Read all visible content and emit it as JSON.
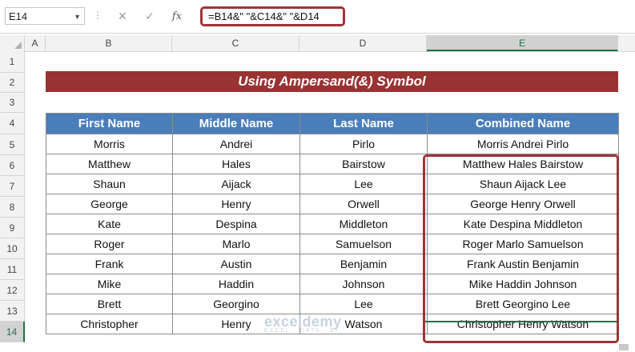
{
  "formula_bar": {
    "name_box": "E14",
    "cancel_icon": "✕",
    "enter_icon": "✓",
    "fx_label": "fx",
    "formula": "=B14&\" \"&C14&\" \"&D14"
  },
  "columns": [
    "A",
    "B",
    "C",
    "D",
    "E"
  ],
  "rows": [
    "1",
    "2",
    "3",
    "4",
    "5",
    "6",
    "7",
    "8",
    "9",
    "10",
    "11",
    "12",
    "13",
    "14"
  ],
  "active_cell": {
    "column": "E",
    "row": "14"
  },
  "title": "Using Ampersand(&) Symbol",
  "table": {
    "headers": [
      "First Name",
      "Middle Name",
      "Last Name",
      "Combined Name"
    ],
    "rows": [
      [
        "Morris",
        "Andrei",
        "Pirlo",
        "Morris Andrei Pirlo"
      ],
      [
        "Matthew",
        "Hales",
        "Bairstow",
        "Matthew Hales Bairstow"
      ],
      [
        "Shaun",
        "Aijack",
        "Lee",
        "Shaun Aijack Lee"
      ],
      [
        "George",
        "Henry",
        "Orwell",
        "George Henry Orwell"
      ],
      [
        "Kate",
        "Despina",
        "Middleton",
        "Kate Despina Middleton"
      ],
      [
        "Roger",
        "Marlo",
        "Samuelson",
        "Roger Marlo Samuelson"
      ],
      [
        "Frank",
        "Austin",
        "Benjamin",
        "Frank Austin Benjamin"
      ],
      [
        "Mike",
        "Haddin",
        "Johnson",
        "Mike Haddin Johnson"
      ],
      [
        "Brett",
        "Georgino",
        "Lee",
        "Brett Georgino Lee"
      ],
      [
        "Christopher",
        "Henry",
        "Watson",
        "Christopher Henry Watson"
      ]
    ]
  },
  "watermark": {
    "brand": "exceldemy",
    "tagline": "EXCEL · DATA · BI"
  },
  "colors": {
    "title_bg": "#993333",
    "header_bg": "#4a7ebb",
    "highlight": "#9e3437",
    "active": "#217346"
  }
}
